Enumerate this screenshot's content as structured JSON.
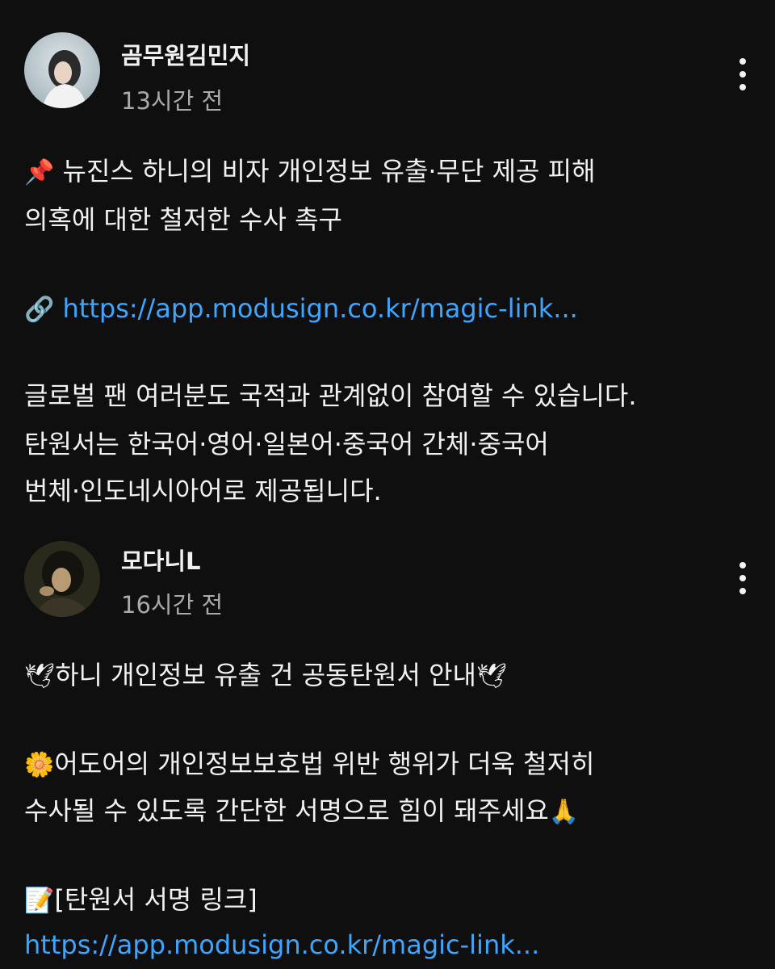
{
  "comments": [
    {
      "author": "곰무원김민지",
      "time": "13시간 전",
      "line1": "뉴진스 하니의 비자 개인정보 유출·무단 제공 피해",
      "line2": "의혹에 대한 철저한 수사 촉구",
      "link": "https://app.modusign.co.kr/magic-link...",
      "line4": "글로벌 팬 여러분도 국적과 관계없이 참여할 수 있습니다.",
      "line5": "탄원서는 한국어·영어·일본어·중국어 간체·중국어",
      "line6": "번체·인도네시아어로 제공됩니다."
    },
    {
      "author": "모다니L",
      "time": "16시간 전",
      "line1": "하니 개인정보 유출 건 공동탄원서 안내",
      "line2": "어도어의 개인정보보호법 위반 행위가 더욱 철저히",
      "line3": "수사될 수 있도록 간단한 서명으로 힘이 돼주세요",
      "line4": "[탄원서 서명 링크]",
      "link": "https://app.modusign.co.kr/magic-link..."
    }
  ],
  "icons": {
    "pin": "pushpin-icon",
    "link": "link-icon",
    "dove": "dove-icon",
    "flower": "flower-icon",
    "pray": "praying-hands-icon",
    "memo": "memo-icon",
    "menu": "more-vertical-icon"
  },
  "colors": {
    "background": "#0f0f0f",
    "text": "#f1f1f1",
    "muted": "#aaaaaa",
    "link": "#3ea6ff"
  }
}
